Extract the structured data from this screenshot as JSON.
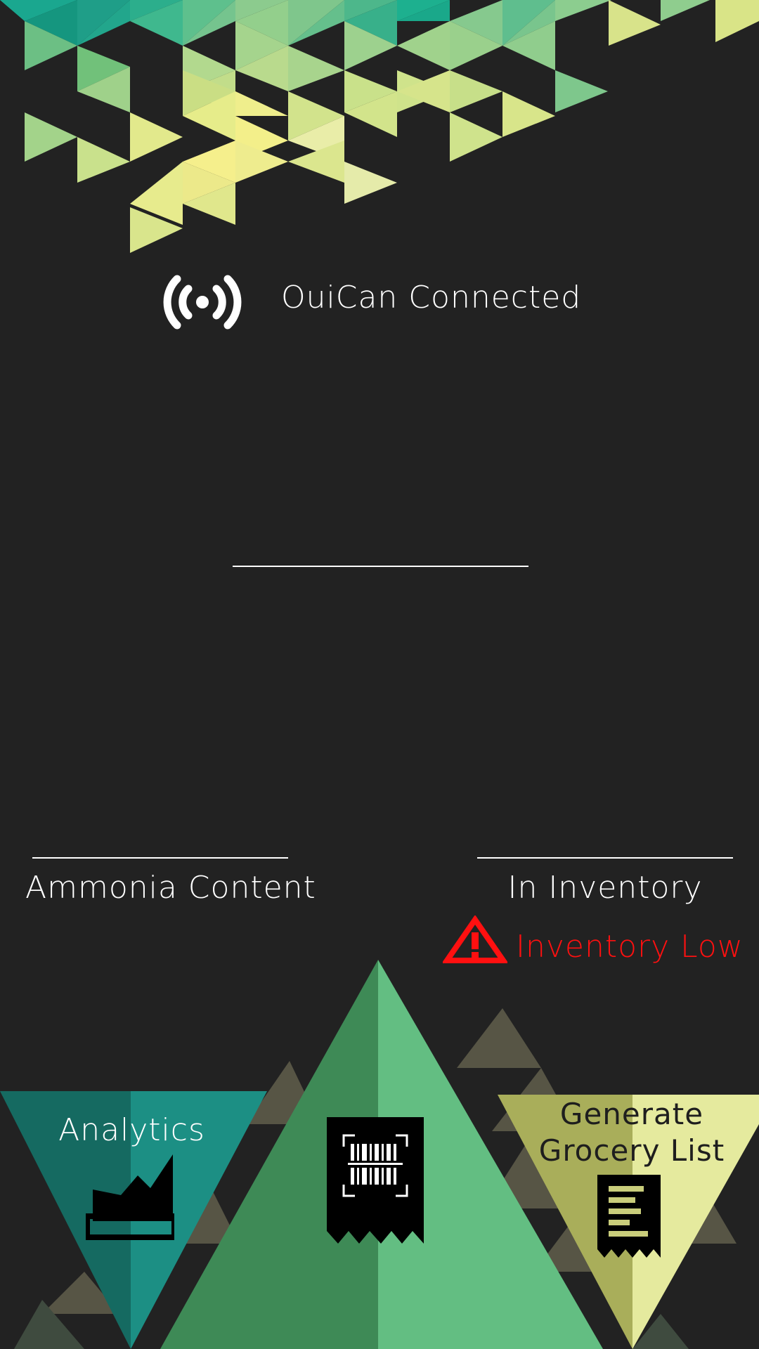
{
  "status": {
    "label": "OuiCan Connected",
    "icon": "broadcast-signal-icon"
  },
  "metrics": {
    "ammonia_label": "Ammonia Content",
    "inventory_label": "In Inventory"
  },
  "alert": {
    "label": "Inventory Low",
    "icon": "warning-triangle-icon",
    "color": "#ff1010"
  },
  "nav": {
    "analytics_label": "Analytics",
    "analytics_icon": "area-chart-icon",
    "scan_icon": "barcode-receipt-icon",
    "grocery_label": "Generate Grocery List",
    "grocery_icon": "receipt-list-icon"
  },
  "colors": {
    "background": "#222222",
    "teal": "#1a8c80",
    "green": "#4fae6d",
    "lime": "#dfe49a",
    "warning": "#ff1010"
  }
}
